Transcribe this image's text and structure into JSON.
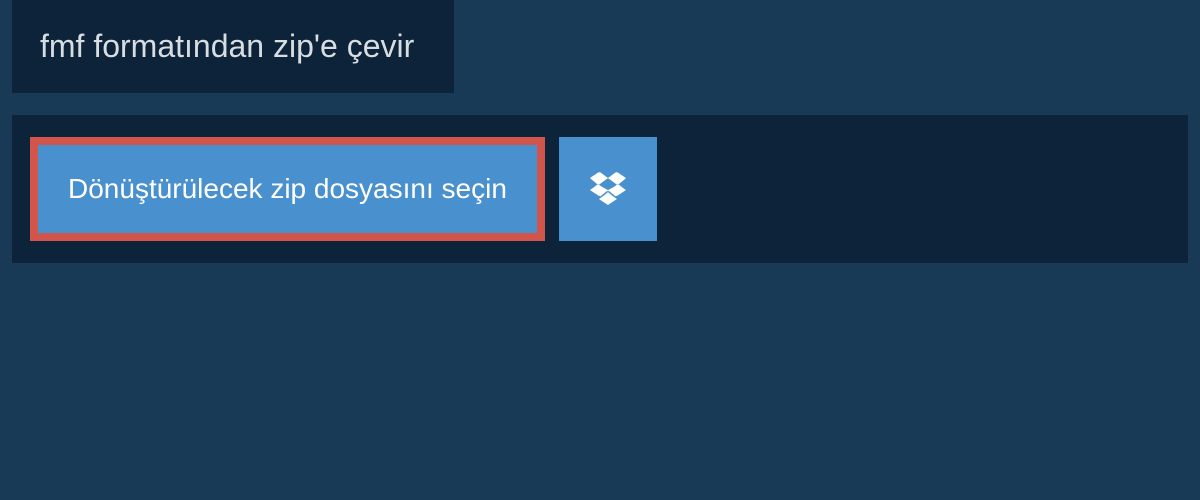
{
  "header": {
    "title": "fmf formatından zip'e çevir"
  },
  "actions": {
    "choose_file_label": "Dönüştürülecek zip dosyasını seçin"
  }
}
